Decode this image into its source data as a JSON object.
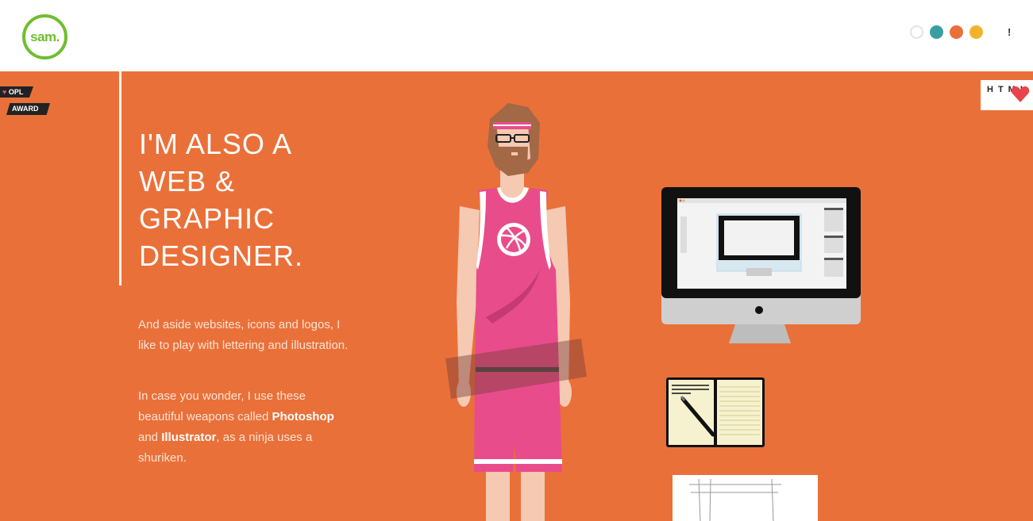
{
  "header": {
    "logo_text": "sam.",
    "swatches": [
      {
        "name": "white",
        "color": "#ffffff"
      },
      {
        "name": "teal",
        "color": "#3a9ea1"
      },
      {
        "name": "orange",
        "color": "#ea7039"
      },
      {
        "name": "yellow",
        "color": "#f0b42c"
      }
    ],
    "extra_label": "!"
  },
  "award": {
    "line1": "OPL",
    "line2": "AWARD",
    "heart_icon": "heart-icon"
  },
  "html_badge": {
    "text": "HTML"
  },
  "hero": {
    "title": "I'M ALSO A WEB & GRAPHIC DESIGNER.",
    "para1": "And aside websites, icons and logos, I like to play with lettering and illustration.",
    "para2_pre": "In case you wonder, I use these beautiful weapons called ",
    "para2_tool1": "Photoshop",
    "para2_mid": " and ",
    "para2_tool2": "Illustrator",
    "para2_post": ", as a ninja uses a shuriken."
  },
  "colors": {
    "accent_green": "#6fbe2f",
    "hero_bg": "#ea7039",
    "jersey_pink": "#e84c8b"
  }
}
